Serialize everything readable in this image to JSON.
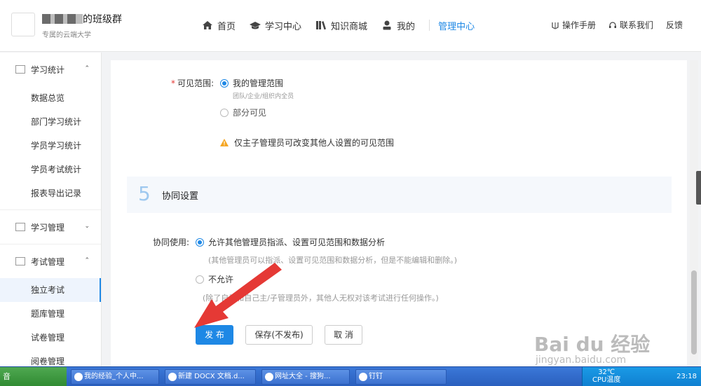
{
  "header": {
    "org_name_suffix": "的班级群",
    "org_sub": "专属的云端大学",
    "nav": [
      {
        "label": "首页",
        "icon": "home-icon"
      },
      {
        "label": "学习中心",
        "icon": "graduation-cap-icon"
      },
      {
        "label": "知识商城",
        "icon": "books-icon"
      },
      {
        "label": "我的",
        "icon": "user-icon"
      },
      {
        "label": "管理中心",
        "icon": ""
      }
    ],
    "right_links": [
      {
        "label": "操作手册",
        "icon": "manual-icon"
      },
      {
        "label": "联系我们",
        "icon": "headset-icon"
      },
      {
        "label": "反馈",
        "icon": ""
      }
    ]
  },
  "sidebar": {
    "groups": [
      {
        "label": "学习统计",
        "arrow": "⌃",
        "items": [
          "数据总览",
          "部门学习统计",
          "学员学习统计",
          "学员考试统计",
          "报表导出记录"
        ]
      },
      {
        "label": "学习管理",
        "arrow": "⌄",
        "items": []
      },
      {
        "label": "考试管理",
        "arrow": "⌃",
        "items": [
          "独立考试",
          "题库管理",
          "试卷管理",
          "阅卷管理"
        ]
      }
    ]
  },
  "form": {
    "visibility_label": "可见范围:",
    "visibility_opt1": "我的管理范围",
    "visibility_opt1_desc": "团队/企业/组织内全员",
    "visibility_opt2": "部分可见",
    "warning": "仅主子管理员可改变其他人设置的可见范围",
    "section_num": "5",
    "section_title": "协同设置",
    "collab_label": "协同使用:",
    "collab_opt1": "允许其他管理员指派、设置可见范围和数据分析",
    "collab_opt1_desc": "(其他管理员可以指派、设置可见范围和数据分析，但是不能编辑和删除。)",
    "collab_opt2": "不允许",
    "collab_opt2_desc": "(除了自己和自己主/子管理员外，其他人无权对该考试进行任何操作。)",
    "publish": "发 布",
    "save_draft": "保存(不发布)",
    "cancel": "取 消"
  },
  "taskbar": {
    "start": "音",
    "items": [
      "我的经验_个人中...",
      "新建 DOCX 文档.d...",
      "网址大全 - 搜狗...",
      "钉钉"
    ],
    "temp": "32℃",
    "temp_label": "CPU温度",
    "clock": "23:18"
  },
  "watermark": {
    "main": "Bai du 经验",
    "sub": "jingyan.baidu.com"
  },
  "colors": {
    "accent": "#1e88e5",
    "required": "#e53935",
    "warning": "#f5a623",
    "arrow": "#e53935"
  }
}
